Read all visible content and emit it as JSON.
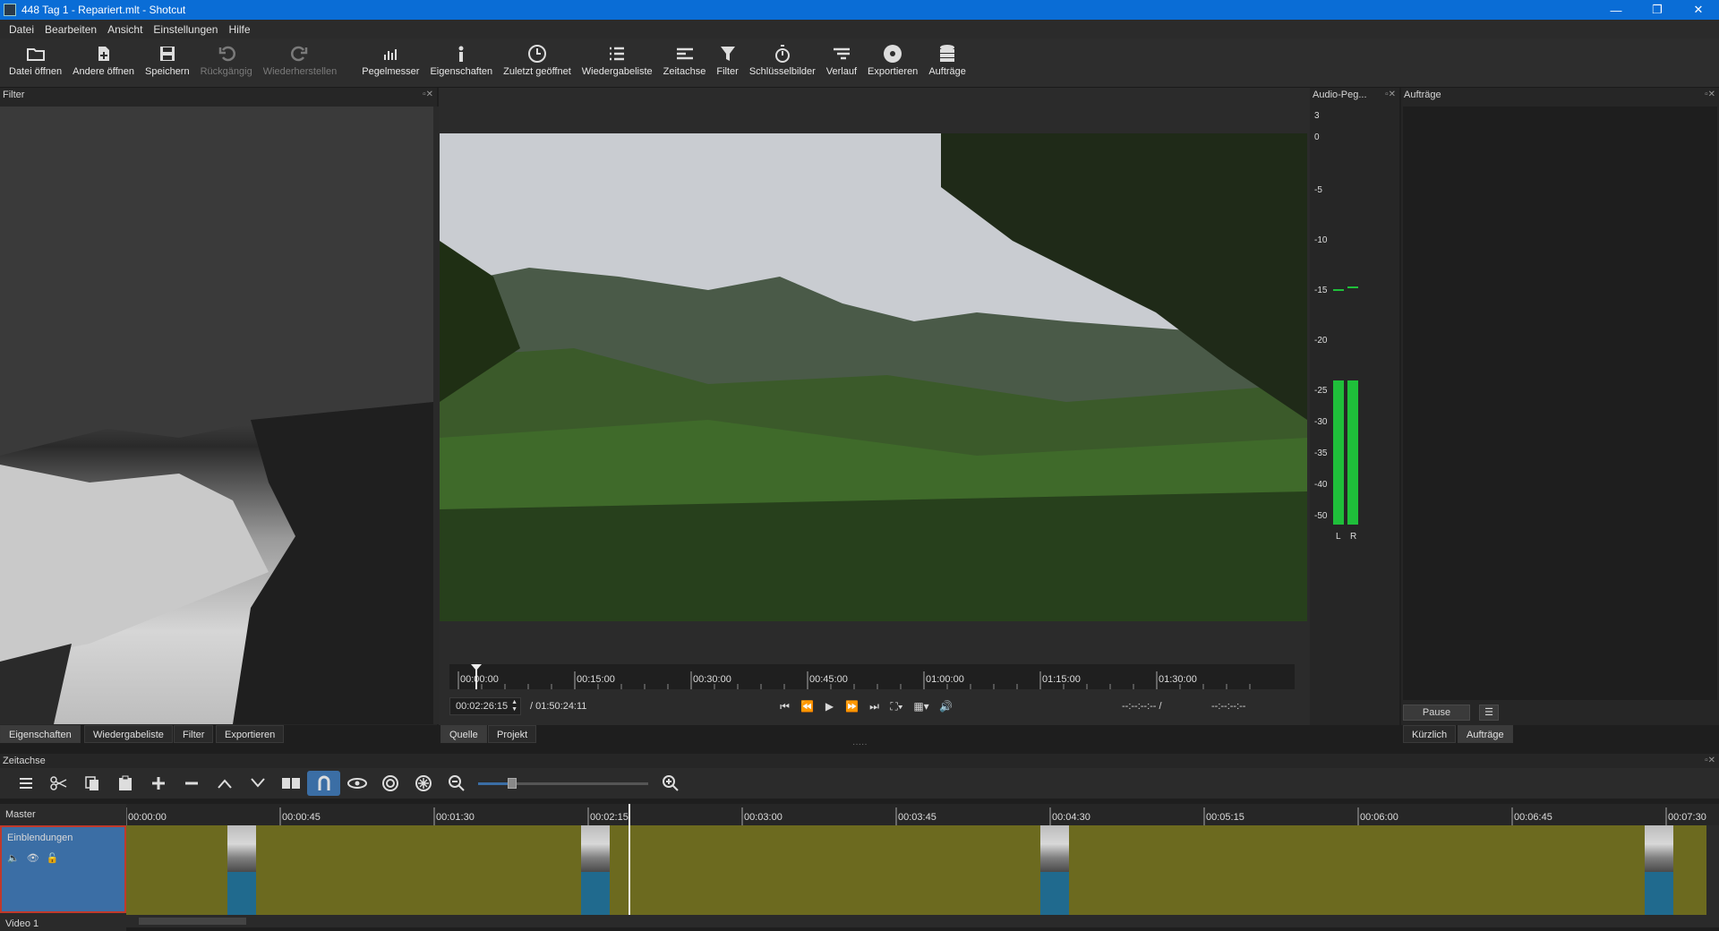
{
  "window": {
    "title": "448 Tag 1 - Repariert.mlt - Shotcut",
    "controls": [
      "—",
      "❐",
      "✕"
    ]
  },
  "menu": [
    "Datei",
    "Bearbeiten",
    "Ansicht",
    "Einstellungen",
    "Hilfe"
  ],
  "toolbar": {
    "open": "Datei öffnen",
    "open_other": "Andere öffnen",
    "save": "Speichern",
    "undo": "Rückgängig",
    "redo": "Wiederherstellen",
    "meter": "Pegelmesser",
    "properties": "Eigenschaften",
    "recent": "Zuletzt geöffnet",
    "playlist": "Wiedergabeliste",
    "timeline": "Zeitachse",
    "filter": "Filter",
    "keyframes": "Schlüsselbilder",
    "history": "Verlauf",
    "export": "Exportieren",
    "jobs": "Aufträge"
  },
  "filter_panel": {
    "title": "Filter",
    "tabs": [
      "Eigenschaften",
      "Wiedergabeliste",
      "Filter",
      "Exportieren"
    ]
  },
  "player": {
    "ruler": [
      "00:00:00",
      "00:15:00",
      "00:30:00",
      "00:45:00",
      "01:00:00",
      "01:15:00",
      "01:30:00"
    ],
    "timecode": "00:02:26:15",
    "duration": "/ 01:50:24:11",
    "in_point": "--:--:--:-- /",
    "out_point": "--:--:--:--",
    "tabs": [
      "Quelle",
      "Projekt"
    ],
    "playhead_fraction": 0.022
  },
  "audio_meter": {
    "title": "Audio-Peg...",
    "scale": [
      "3",
      "0",
      "-5",
      "-10",
      "-15",
      "-20",
      "-25",
      "-30",
      "-35",
      "-40",
      "-50"
    ],
    "channels": [
      "L",
      "R"
    ],
    "level_db": -25,
    "peak_db": -15,
    "color": "#1fbf3a"
  },
  "jobs_panel": {
    "title": "Aufträge",
    "pause": "Pause",
    "menu": "☰",
    "tabs": [
      "Kürzlich",
      "Aufträge"
    ]
  },
  "timeline": {
    "title": "Zeitachse",
    "ruler": [
      "00:00:00",
      "00:00:45",
      "00:01:30",
      "00:02:15",
      "00:03:00",
      "00:03:45",
      "00:04:30",
      "00:05:15",
      "00:06:00",
      "00:06:45",
      "00:07:30"
    ],
    "tracks": [
      {
        "name": "Master"
      },
      {
        "name": "Einblendungen"
      },
      {
        "name": "Video 1"
      }
    ],
    "clip_color": "#6c6a1f",
    "transition_color": "#206a8e",
    "playhead_time": "00:02:26:15",
    "zoom_fraction": 0.2
  }
}
